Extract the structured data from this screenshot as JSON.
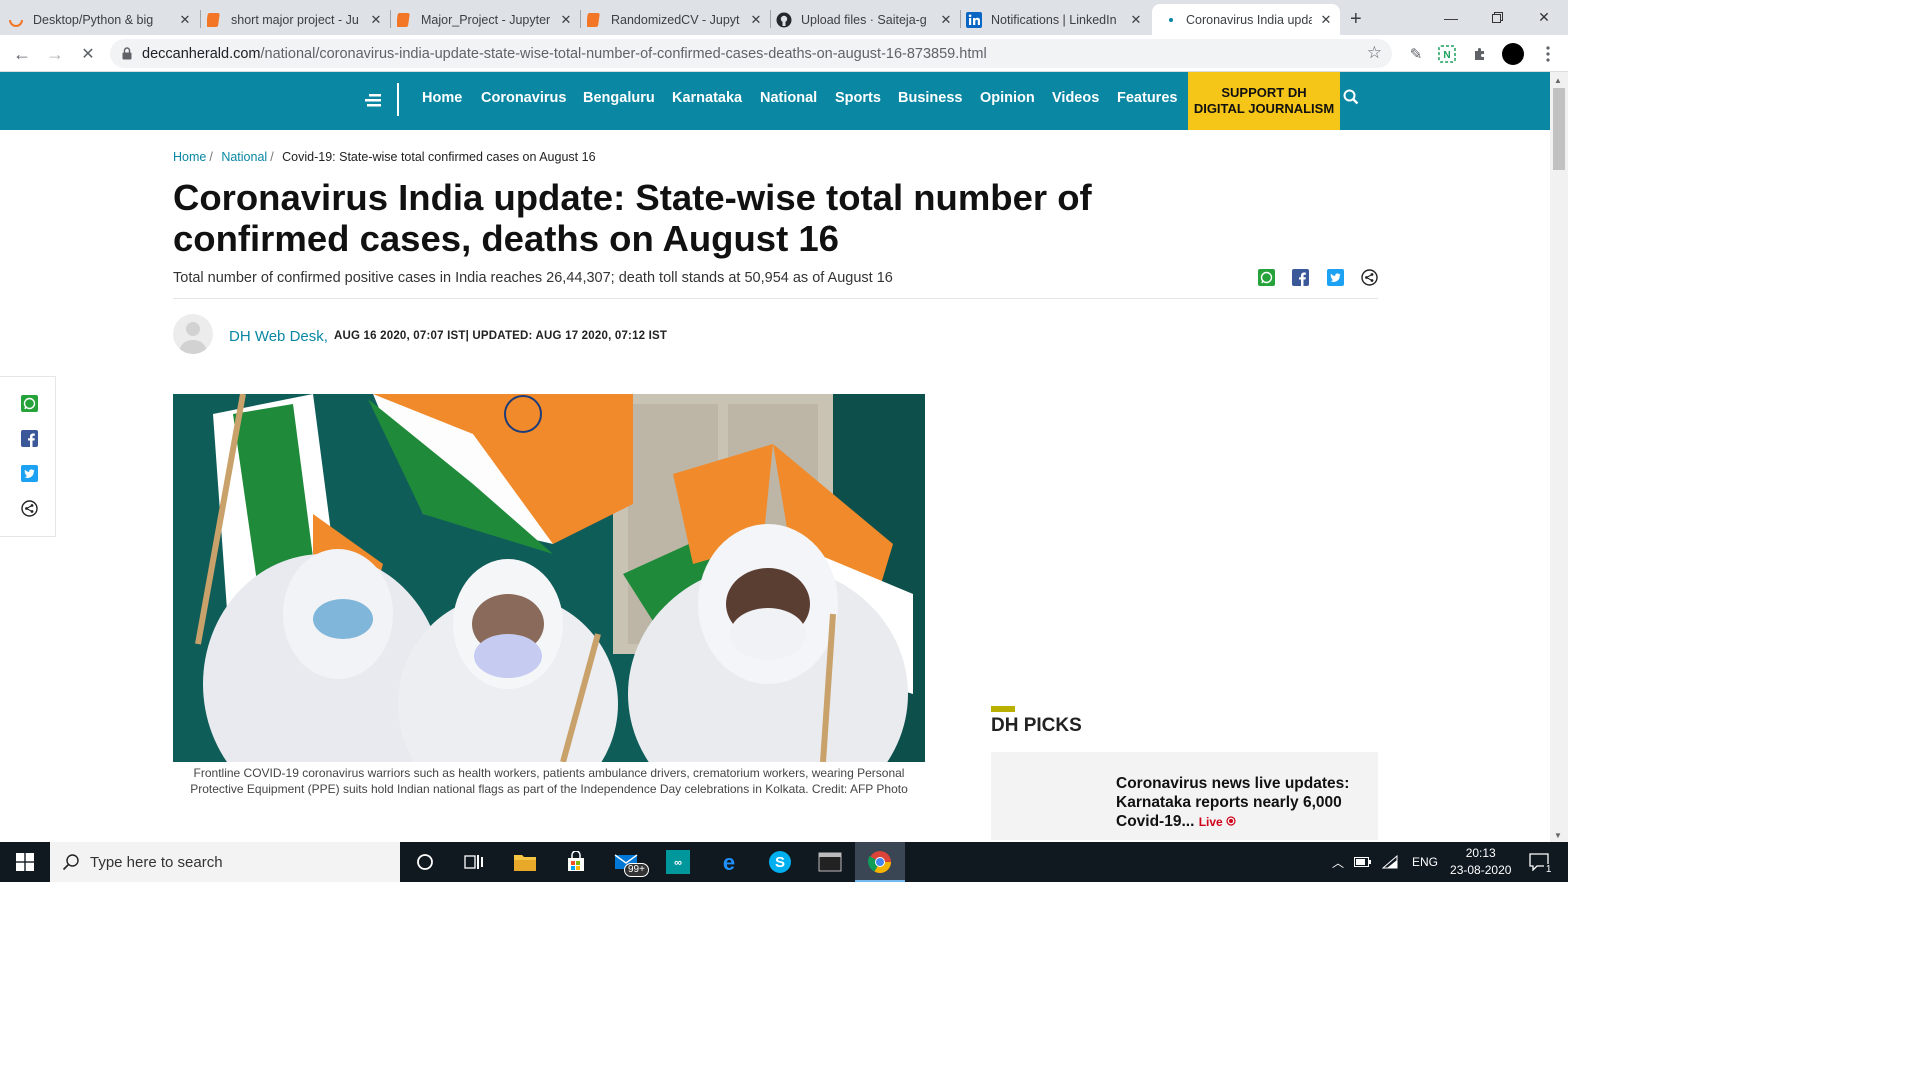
{
  "browser": {
    "tabs": [
      {
        "label": "Desktop/Python & big",
        "icon": "loading-ring-icon",
        "color": "#f37626"
      },
      {
        "label": "short major project - Ju",
        "icon": "jupyter-icon",
        "color": "#f37626"
      },
      {
        "label": "Major_Project - Jupyter",
        "icon": "jupyter-icon",
        "color": "#f37626"
      },
      {
        "label": "RandomizedCV - Jupyt",
        "icon": "jupyter-icon",
        "color": "#f37626"
      },
      {
        "label": "Upload files · Saiteja-g",
        "icon": "github-icon",
        "color": "#24292e"
      },
      {
        "label": "Notifications | LinkedIn",
        "icon": "linkedin-icon",
        "color": "#0a66c2"
      },
      {
        "label": "Coronavirus India upda",
        "icon": "loading-dot-icon",
        "color": "#0a87a3"
      }
    ],
    "url_host": "deccanherald.com",
    "url_path": "/national/coronavirus-india-update-state-wise-total-number-of-confirmed-cases-deaths-on-august-16-873859.html"
  },
  "site": {
    "nav": [
      "Home",
      "Coronavirus",
      "Bengaluru",
      "Karnataka",
      "National",
      "Sports",
      "Business",
      "Opinion",
      "Videos",
      "Features"
    ],
    "support_line1": "SUPPORT DH",
    "support_line2": "DIGITAL JOURNALISM",
    "brand_color": "#0a87a3",
    "support_color": "#f5c518"
  },
  "article": {
    "breadcrumb": [
      "Home",
      "National",
      "Covid-19: State-wise total confirmed cases on August 16"
    ],
    "title": "Coronavirus India update: State-wise total number of confirmed cases, deaths on August 16",
    "summary": "Total number of confirmed positive cases in India reaches 26,44,307; death toll stands at 50,954 as of August 16",
    "author": "DH Web Desk,",
    "dates": "AUG 16 2020, 07:07 IST| UPDATED: AUG 17 2020, 07:12 IST",
    "caption": "Frontline COVID-19 coronavirus warriors such as health workers, patients ambulance drivers, crematorium workers, wearing Personal Protective Equipment (PPE) suits hold Indian national flags as part of the Independence Day celebrations in Kolkata. Credit: AFP Photo",
    "share_icons": [
      "whatsapp-icon",
      "facebook-icon",
      "twitter-icon",
      "share-icon"
    ]
  },
  "picks": {
    "heading": "DH PICKS",
    "item_title": "Coronavirus news live updates: Karnataka reports nearly 6,000 Covid-19...",
    "live_label": "Live"
  },
  "taskbar": {
    "search_placeholder": "Type here to search",
    "mail_badge": "99+",
    "language": "ENG",
    "time": "20:13",
    "date": "23-08-2020",
    "notification_count": "1"
  }
}
